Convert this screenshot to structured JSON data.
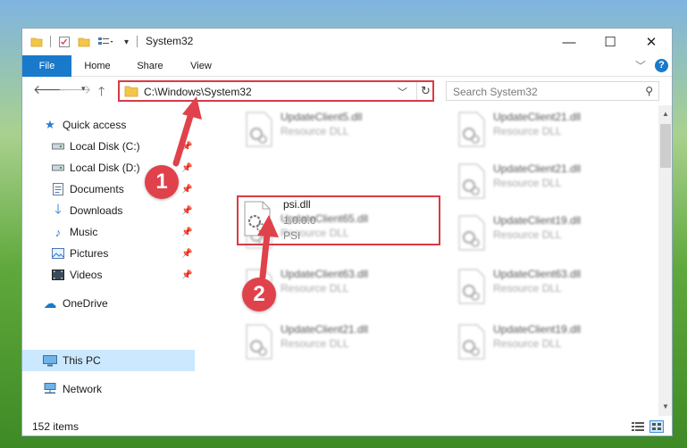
{
  "window": {
    "title": "System32",
    "controls": {
      "minimize": "—",
      "maximize": "☐",
      "close": "✕"
    }
  },
  "ribbon": {
    "tabs": [
      "File",
      "Home",
      "Share",
      "View"
    ]
  },
  "nav": {
    "address": "C:\\Windows\\System32",
    "search_placeholder": "Search System32"
  },
  "sidebar": {
    "items": [
      {
        "label": "Quick access",
        "icon": "star-icon"
      },
      {
        "label": "Local Disk (C:)",
        "icon": "drive-icon",
        "pinned": true
      },
      {
        "label": "Local Disk (D:)",
        "icon": "drive-icon",
        "pinned": true
      },
      {
        "label": "Documents",
        "icon": "documents-icon",
        "pinned": true
      },
      {
        "label": "Downloads",
        "icon": "download-icon",
        "pinned": true
      },
      {
        "label": "Music",
        "icon": "music-icon",
        "pinned": true
      },
      {
        "label": "Pictures",
        "icon": "pictures-icon",
        "pinned": true
      },
      {
        "label": "Videos",
        "icon": "videos-icon",
        "pinned": true
      },
      {
        "label": "OneDrive",
        "icon": "cloud-icon"
      },
      {
        "label": "This PC",
        "icon": "computer-icon",
        "selected": true
      },
      {
        "label": "Network",
        "icon": "network-icon"
      }
    ]
  },
  "files": {
    "focused": {
      "name": "psi.dll",
      "version": "1.0.0.0",
      "description": "PSI"
    },
    "left": [
      {
        "name": "UpdateClient5.dll",
        "desc": "Resource DLL"
      },
      {
        "name": "UpdateClient65.dll",
        "desc": "Resource DLL"
      },
      {
        "name": "UpdateClient63.dll",
        "desc": "Resource DLL"
      },
      {
        "name": "UpdateClient21.dll",
        "desc": "Resource DLL"
      }
    ],
    "right": [
      {
        "name": "UpdateClient21.dll",
        "desc": "Resource DLL"
      },
      {
        "name": "UpdateClient21.dll",
        "desc": "Resource DLL"
      },
      {
        "name": "UpdateClient19.dll",
        "desc": "Resource DLL"
      },
      {
        "name": "UpdateClient63.dll",
        "desc": "Resource DLL"
      },
      {
        "name": "UpdateClient19.dll",
        "desc": "Resource DLL"
      }
    ]
  },
  "status": {
    "count": "152 items"
  },
  "callouts": [
    "1",
    "2"
  ],
  "colors": {
    "accent": "#1979ca",
    "highlight": "#d93a45",
    "callout": "#e0424b",
    "selected": "#cce8ff"
  }
}
